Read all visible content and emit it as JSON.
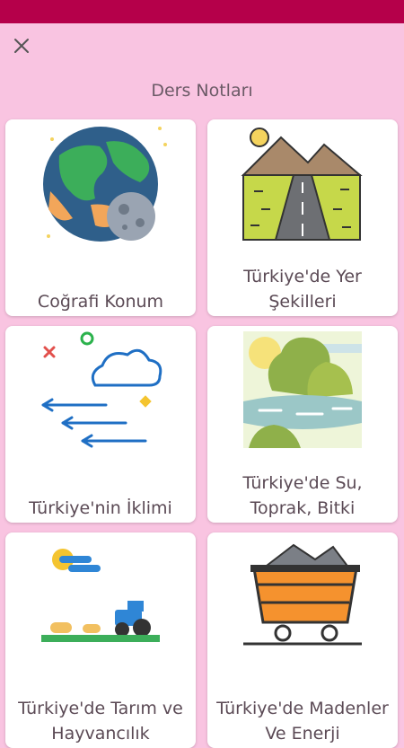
{
  "header": {
    "title": "Ders Notları",
    "close_icon": "close-icon"
  },
  "colors": {
    "status_bar": "#b5004a",
    "background": "#f9c4e1",
    "card": "#ffffff",
    "text": "#5b4a55"
  },
  "cards": [
    {
      "label": "Coğrafi Konum",
      "icon": "earth-moon-icon"
    },
    {
      "label": "Türkiye'de Yer Şekilleri",
      "icon": "mountain-road-icon"
    },
    {
      "label": "Türkiye'nin İklimi",
      "icon": "cloud-wind-icon"
    },
    {
      "label": "Türkiye'de Su, Toprak, Bitki",
      "icon": "lake-trees-icon"
    },
    {
      "label": "Türkiye'de Tarım ve Hayvancılık",
      "icon": "tractor-field-icon"
    },
    {
      "label": "Türkiye'de Madenler Ve Enerji",
      "icon": "mine-cart-icon"
    }
  ]
}
